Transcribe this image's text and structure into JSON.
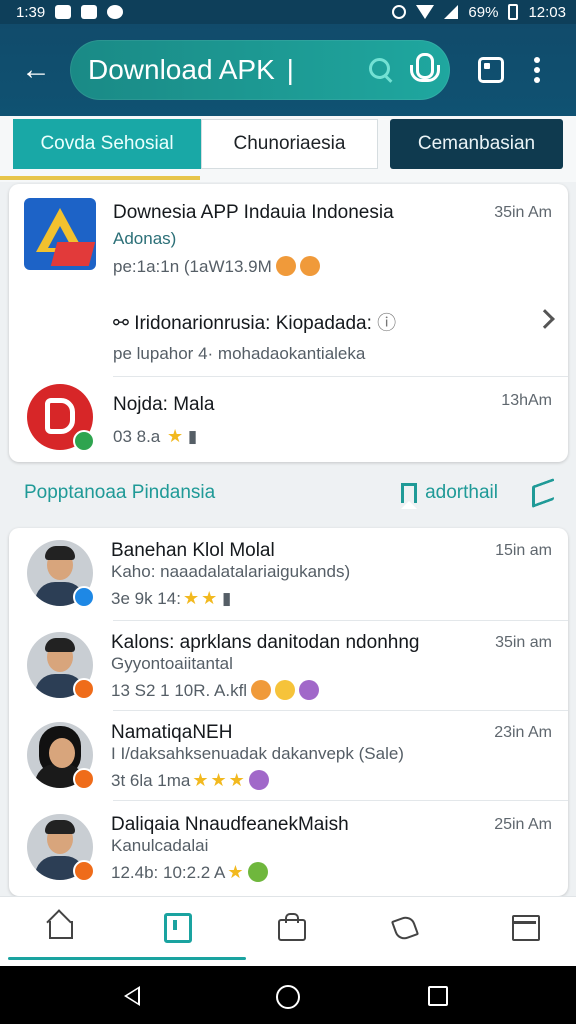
{
  "status_bar": {
    "time_left": "1:39",
    "battery": "69%",
    "time_right": "12:03"
  },
  "app_bar": {
    "search_query": "Download APK",
    "caret": "|"
  },
  "category_tabs": [
    {
      "label": "Covda Sehosial"
    },
    {
      "label": "Chunoriaesia"
    },
    {
      "label": "Cemanbasian"
    }
  ],
  "featured": [
    {
      "title": "Downesia APP Indauia Indonesia",
      "subtitle": "Adonas)",
      "meta": "pe:1a:1n (1aW13.9M",
      "time": "35in Am",
      "details_title": "Iridonarionrusia: Kiopadada:",
      "details_meta": "pe lupahor 4·  mohadaokantialeka"
    },
    {
      "title": "Nojda: Mala",
      "meta": "03 8.a",
      "time": "13hAm"
    }
  ],
  "section": {
    "title": "Popptanoaa Pindansia",
    "link_label": "adorthail"
  },
  "list": [
    {
      "name": "Banehan Klol Molal",
      "desc": "Kaho: naaadalatalariaigukands)",
      "meta": "3e 9k 14:",
      "time": "15in am"
    },
    {
      "name": "Kalons: aprklans danitodan ndonhng",
      "desc": "Gyyontoaiitantal",
      "meta": "13 S2 1 10R. A.kfl",
      "time": "35in am"
    },
    {
      "name": "NamatiqaNEH",
      "desc": "I I/daksahksenuadak dakanvepk (Sale)",
      "meta": "3t 6la 1ma",
      "time": "23in Am"
    },
    {
      "name": "Daliqaia NnaudfeanekMaish",
      "desc": "Kanulcadalai",
      "meta": "12.4b: 10:2.2 A",
      "time": "25in Am"
    }
  ],
  "icons": {
    "back": "arrow-left",
    "search": "search",
    "mic": "microphone",
    "tabs": "tabs-square",
    "more": "more-vertical",
    "nav": [
      "home",
      "store",
      "shopping-bag",
      "share",
      "calendar"
    ]
  },
  "colors": {
    "app_bar": "#0f5272",
    "accent": "#1aa3a0",
    "tab_indicator": "#e7c54a"
  }
}
